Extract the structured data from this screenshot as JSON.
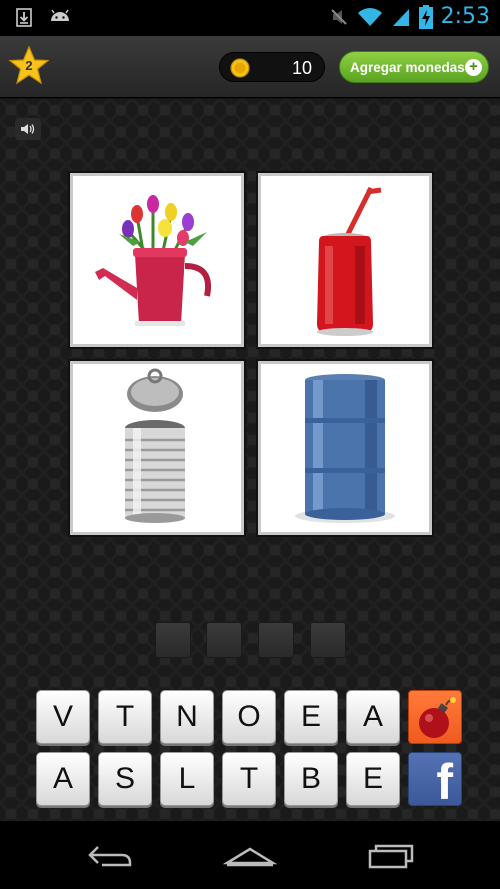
{
  "status_bar": {
    "time": "2:53",
    "icons": [
      "download-icon",
      "android-icon",
      "mute-icon",
      "wifi-icon",
      "signal-icon",
      "battery-charging-icon"
    ]
  },
  "top_bar": {
    "level": "2",
    "coins": "10",
    "add_coins_label": "Agregar monedas",
    "add_icon": "+"
  },
  "puzzle": {
    "images": [
      "watering-can-with-tulips",
      "red-soda-can-with-straw",
      "open-tin-can",
      "blue-steel-barrel"
    ],
    "answer_slots": 4
  },
  "letters": {
    "row1": [
      "V",
      "T",
      "N",
      "O",
      "E",
      "A"
    ],
    "row2": [
      "A",
      "S",
      "L",
      "T",
      "B",
      "E"
    ]
  },
  "actions": {
    "bomb_icon": "bomb-icon",
    "facebook_label": "f"
  },
  "nav_bar": {
    "icons": [
      "back-icon",
      "home-icon",
      "recent-apps-icon"
    ]
  },
  "colors": {
    "status_accent": "#33b5e5",
    "add_coins_green": "#6ab82c",
    "bomb_orange": "#f05a1e",
    "facebook_blue": "#3b5998"
  }
}
